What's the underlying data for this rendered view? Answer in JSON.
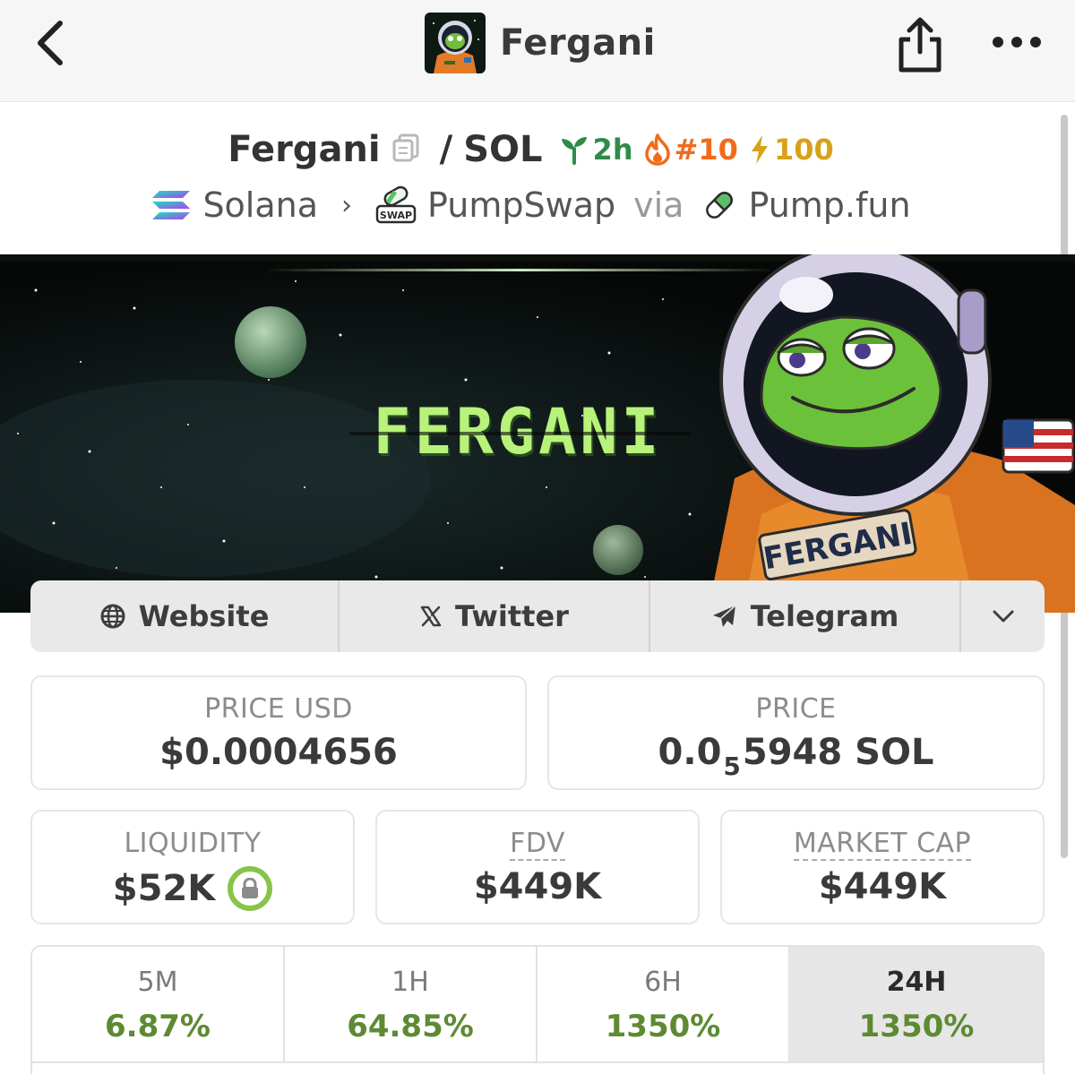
{
  "nav": {
    "title": "Fergani"
  },
  "pair": {
    "base": "Fergani",
    "separator": "/",
    "quote": "SOL",
    "age": "2h",
    "rank": "#10",
    "boost": "100"
  },
  "chain": {
    "network": "Solana",
    "dex": "PumpSwap",
    "via": "via",
    "launchpad": "Pump.fun"
  },
  "banner": {
    "title_text": "FERGANI",
    "suit_text": "FERGANI"
  },
  "socials": {
    "website": "Website",
    "twitter": "Twitter",
    "telegram": "Telegram"
  },
  "stats": {
    "price_usd_label": "PRICE USD",
    "price_usd_value": "$0.0004656",
    "price_label": "PRICE",
    "price_prefix": "0.0",
    "price_zeros": "5",
    "price_suffix": "5948 SOL",
    "liquidity_label": "LIQUIDITY",
    "liquidity_value": "$52K",
    "fdv_label": "FDV",
    "fdv_value": "$449K",
    "mcap_label": "MARKET CAP",
    "mcap_value": "$449K"
  },
  "timeframes": [
    {
      "label": "5M",
      "value": "6.87%"
    },
    {
      "label": "1H",
      "value": "64.85%"
    },
    {
      "label": "6H",
      "value": "1350%"
    },
    {
      "label": "24H",
      "value": "1350%"
    }
  ],
  "colors": {
    "positive": "#5d8a32",
    "age_green": "#2e8b4a",
    "rank_orange": "#f36a1b",
    "boost_yellow": "#d7a218",
    "lock_green": "#88c34a"
  },
  "icons": {
    "back": "chevron-left-icon",
    "share": "share-icon",
    "more": "more-icon",
    "copy": "copy-icon",
    "age": "sprout-icon",
    "rank": "flame-icon",
    "boost": "lightning-icon",
    "network": "solana-icon",
    "dex": "pumpswap-icon",
    "launchpad": "pill-icon",
    "website": "globe-icon",
    "twitter": "x-icon",
    "telegram": "telegram-icon",
    "socials_more": "chevron-down-icon",
    "lock": "lock-icon"
  }
}
